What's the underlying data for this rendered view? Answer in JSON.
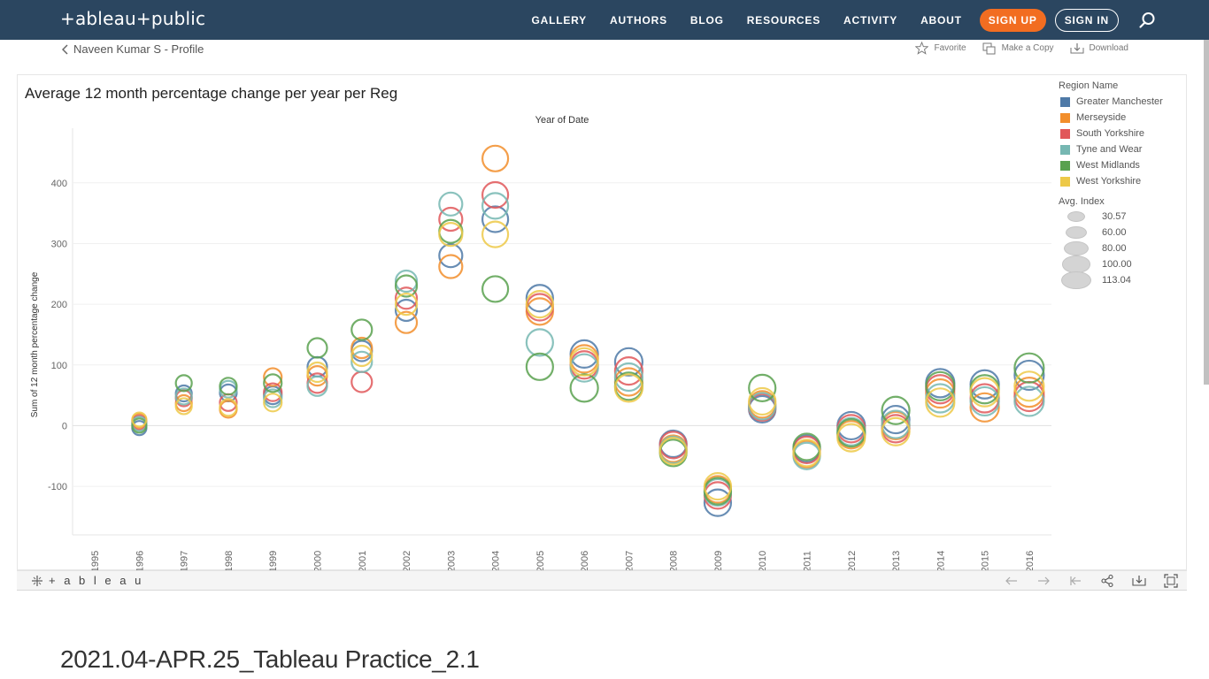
{
  "nav": {
    "logo": "+ableau+public",
    "links": [
      "GALLERY",
      "AUTHORS",
      "BLOG",
      "RESOURCES",
      "ACTIVITY",
      "ABOUT"
    ],
    "signup": "SIGN UP",
    "signin": "SIGN IN"
  },
  "profile": {
    "back_label": "Naveen Kumar S - Profile",
    "favorite": "Favorite",
    "make_copy": "Make a Copy",
    "download": "Download"
  },
  "viz": {
    "title": "Average 12 month percentage change per year per Reg",
    "legend_title": "Region Name",
    "size_title": "Avg. Index",
    "toolbar_logo": "+ a b l e a u"
  },
  "page": {
    "heading": "2021.04-APR.25_Tableau Practice_2.1"
  },
  "chart_data": {
    "type": "scatter",
    "title": "Average 12 month percentage change per year per Reg",
    "xlabel": "Year of Date",
    "ylabel": "Sum of 12 month percentage change",
    "ylim": [
      -180,
      490
    ],
    "yticks": [
      -100,
      0,
      100,
      200,
      300,
      400
    ],
    "categories": [
      "1995",
      "1996",
      "1997",
      "1998",
      "1999",
      "2000",
      "2001",
      "2002",
      "2003",
      "2004",
      "2005",
      "2006",
      "2007",
      "2008",
      "2009",
      "2010",
      "2011",
      "2012",
      "2013",
      "2014",
      "2015",
      "2016"
    ],
    "series": [
      {
        "name": "Greater Manchester",
        "color": "#4e79a7",
        "values": [
          null,
          -4,
          53,
          54,
          50,
          97,
          123,
          190,
          280,
          340,
          210,
          118,
          105,
          -30,
          -127,
          27,
          -38,
          0,
          10,
          70,
          68,
          83
        ]
      },
      {
        "name": "Merseyside",
        "color": "#f28e2b",
        "values": [
          null,
          8,
          37,
          27,
          80,
          82,
          128,
          170,
          262,
          440,
          188,
          110,
          72,
          -38,
          -105,
          35,
          -47,
          -15,
          0,
          53,
          30,
          55
        ]
      },
      {
        "name": "South Yorkshire",
        "color": "#e15759",
        "values": [
          null,
          5,
          45,
          38,
          55,
          70,
          72,
          210,
          340,
          380,
          195,
          100,
          90,
          -32,
          -115,
          30,
          -40,
          -5,
          -5,
          60,
          45,
          48
        ]
      },
      {
        "name": "Tyne and Wear",
        "color": "#76b7b2",
        "values": [
          null,
          3,
          48,
          60,
          45,
          65,
          105,
          238,
          365,
          362,
          137,
          95,
          80,
          -40,
          -110,
          32,
          -50,
          -10,
          2,
          45,
          40,
          40
        ]
      },
      {
        "name": "West Midlands",
        "color": "#59a14f",
        "values": [
          null,
          0,
          70,
          65,
          70,
          128,
          158,
          230,
          320,
          225,
          97,
          62,
          65,
          -45,
          -108,
          62,
          -35,
          -12,
          25,
          65,
          60,
          95
        ]
      },
      {
        "name": "West Yorkshire",
        "color": "#edc948",
        "values": [
          null,
          10,
          32,
          30,
          38,
          88,
          115,
          200,
          315,
          315,
          200,
          105,
          62,
          -42,
          -100,
          40,
          -45,
          -20,
          -10,
          38,
          55,
          65
        ]
      }
    ],
    "size_legend": {
      "title": "Avg. Index",
      "values": [
        "30.57",
        "60.00",
        "80.00",
        "100.00",
        "113.04"
      ]
    },
    "grid": true,
    "legend_position": "right"
  }
}
